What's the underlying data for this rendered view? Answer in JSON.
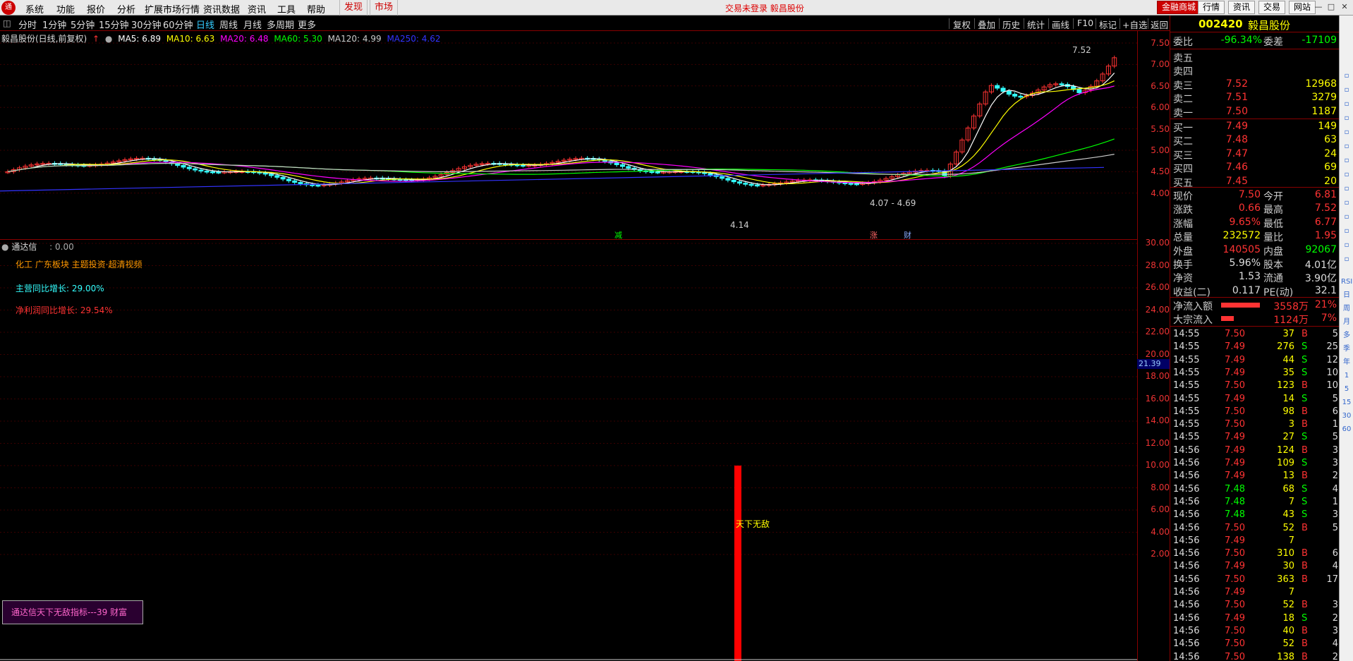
{
  "menubar": {
    "items": [
      "系统",
      "功能",
      "报价",
      "分析",
      "扩展市场行情",
      "资讯数据",
      "资讯",
      "工具",
      "帮助"
    ],
    "tabs": [
      "发现",
      "市场"
    ],
    "status": "交易未登录  毅昌股份",
    "right_buttons": [
      "金融商城",
      "行情",
      "资讯",
      "交易",
      "网站"
    ],
    "logo": "通"
  },
  "periods": [
    "分时",
    "1分钟",
    "5分钟",
    "15分钟",
    "30分钟",
    "60分钟",
    "日线",
    "周线",
    "月线",
    "多周期",
    "更多"
  ],
  "active_period": "日线",
  "toolbar": [
    "复权",
    "叠加",
    "历史",
    "统计",
    "画线",
    "F10",
    "标记",
    "+自选",
    "返回"
  ],
  "chart": {
    "title": "毅昌股份(日线,前复权)",
    "ma": [
      {
        "label": "MA5: 6.89",
        "color": "#ffffff"
      },
      {
        "label": "MA10: 6.63",
        "color": "#ffff00"
      },
      {
        "label": "MA20: 6.48",
        "color": "#ff00ff"
      },
      {
        "label": "MA60: 5.30",
        "color": "#00ff00"
      },
      {
        "label": "MA120: 4.99",
        "color": "#cccccc"
      },
      {
        "label": "MA250: 4.62",
        "color": "#3333ff"
      }
    ],
    "price_axis": [
      "7.50",
      "7.00",
      "6.50",
      "6.00",
      "5.50",
      "5.00",
      "4.50",
      "4.00"
    ],
    "annotations": {
      "high": "7.52",
      "low": "4.14",
      "mid": "4.07 - 4.69",
      "m1": "减",
      "m2": "涨",
      "m3": "财"
    }
  },
  "sub": {
    "name": "通达信",
    "value": ": 0.00",
    "line1": "化工 广东板块 主题投资·超清视频",
    "line2": "主营同比增长: 29.00%",
    "line3": "净利润同比增长: 29.54%",
    "axis": [
      "30.00",
      "28.00",
      "26.00",
      "24.00",
      "22.00",
      "20.00",
      "18.00",
      "16.00",
      "14.00",
      "12.00",
      "10.00",
      "8.00",
      "6.00",
      "4.00",
      "2.00"
    ],
    "cursor_value": "21.39",
    "bar_label": "天下无敌",
    "bar_value": 10,
    "box_text": "通达信天下无敌指标---39 财富"
  },
  "panel": {
    "code": "002420",
    "name": "毅昌股份",
    "weibi_label": "委比",
    "weibi": "-96.34%",
    "weicha_label": "委差",
    "weicha": "-17109",
    "asks": [
      {
        "label": "卖五",
        "price": "",
        "vol": ""
      },
      {
        "label": "卖四",
        "price": "",
        "vol": ""
      },
      {
        "label": "卖三",
        "price": "7.52",
        "vol": "12968"
      },
      {
        "label": "卖二",
        "price": "7.51",
        "vol": "3279"
      },
      {
        "label": "卖一",
        "price": "7.50",
        "vol": "1187"
      }
    ],
    "bids": [
      {
        "label": "买一",
        "price": "7.49",
        "vol": "149"
      },
      {
        "label": "买二",
        "price": "7.48",
        "vol": "63"
      },
      {
        "label": "买三",
        "price": "7.47",
        "vol": "24"
      },
      {
        "label": "买四",
        "price": "7.46",
        "vol": "69"
      },
      {
        "label": "买五",
        "price": "7.45",
        "vol": "20"
      }
    ],
    "quote": [
      {
        "l1": "现价",
        "v1": "7.50",
        "c1": "#ff3333",
        "l2": "今开",
        "v2": "6.81",
        "c2": "#ff3333"
      },
      {
        "l1": "涨跌",
        "v1": "0.66",
        "c1": "#ff3333",
        "l2": "最高",
        "v2": "7.52",
        "c2": "#ff3333"
      },
      {
        "l1": "涨幅",
        "v1": "9.65%",
        "c1": "#ff3333",
        "l2": "最低",
        "v2": "6.77",
        "c2": "#ff3333"
      },
      {
        "l1": "总量",
        "v1": "232572",
        "c1": "#ffff00",
        "l2": "量比",
        "v2": "1.95",
        "c2": "#ff3333"
      },
      {
        "l1": "外盘",
        "v1": "140505",
        "c1": "#ff3333",
        "l2": "内盘",
        "v2": "92067",
        "c2": "#00ff00"
      },
      {
        "l1": "换手",
        "v1": "5.96%",
        "c1": "#dddddd",
        "l2": "股本",
        "v2": "4.01亿",
        "c2": "#dddddd"
      },
      {
        "l1": "净资",
        "v1": "1.53",
        "c1": "#dddddd",
        "l2": "流通",
        "v2": "3.90亿",
        "c2": "#dddddd"
      },
      {
        "l1": "收益(二)",
        "v1": "0.117",
        "c1": "#dddddd",
        "l2": "PE(动)",
        "v2": "32.1",
        "c2": "#dddddd"
      }
    ],
    "flows": [
      {
        "label": "净流入额",
        "value": "3558万",
        "pct": "21%",
        "fill": 0.21
      },
      {
        "label": "大宗流入",
        "value": "1124万",
        "pct": "7%",
        "fill": 0.07
      }
    ],
    "ticks": [
      [
        "14:55",
        "7.50",
        "37",
        "B",
        "5"
      ],
      [
        "14:55",
        "7.49",
        "276",
        "S",
        "25"
      ],
      [
        "14:55",
        "7.49",
        "44",
        "S",
        "12"
      ],
      [
        "14:55",
        "7.49",
        "35",
        "S",
        "10"
      ],
      [
        "14:55",
        "7.50",
        "123",
        "B",
        "10"
      ],
      [
        "14:55",
        "7.49",
        "14",
        "S",
        "5"
      ],
      [
        "14:55",
        "7.50",
        "98",
        "B",
        "6"
      ],
      [
        "14:55",
        "7.50",
        "3",
        "B",
        "1"
      ],
      [
        "14:55",
        "7.49",
        "27",
        "S",
        "5"
      ],
      [
        "14:56",
        "7.49",
        "124",
        "B",
        "3"
      ],
      [
        "14:56",
        "7.49",
        "109",
        "S",
        "3"
      ],
      [
        "14:56",
        "7.49",
        "13",
        "B",
        "2"
      ],
      [
        "14:56",
        "7.48",
        "68",
        "S",
        "4"
      ],
      [
        "14:56",
        "7.48",
        "7",
        "S",
        "1"
      ],
      [
        "14:56",
        "7.48",
        "43",
        "S",
        "3"
      ],
      [
        "14:56",
        "7.50",
        "52",
        "B",
        "5"
      ],
      [
        "14:56",
        "7.49",
        "7",
        "",
        ""
      ],
      [
        "14:56",
        "7.50",
        "310",
        "B",
        "6"
      ],
      [
        "14:56",
        "7.49",
        "30",
        "B",
        "4"
      ],
      [
        "14:56",
        "7.50",
        "363",
        "B",
        "17"
      ],
      [
        "14:56",
        "7.49",
        "7",
        "",
        ""
      ],
      [
        "14:56",
        "7.50",
        "52",
        "B",
        "3"
      ],
      [
        "14:56",
        "7.49",
        "18",
        "S",
        "2"
      ],
      [
        "14:56",
        "7.50",
        "40",
        "B",
        "3"
      ],
      [
        "14:56",
        "7.50",
        "52",
        "B",
        "4"
      ],
      [
        "14:56",
        "7.50",
        "138",
        "B",
        "2"
      ]
    ]
  },
  "rtoolbar": [
    "RSI",
    "日",
    "周",
    "月",
    "多",
    "季",
    "年",
    "1",
    "5",
    "15",
    "30",
    "60"
  ]
}
